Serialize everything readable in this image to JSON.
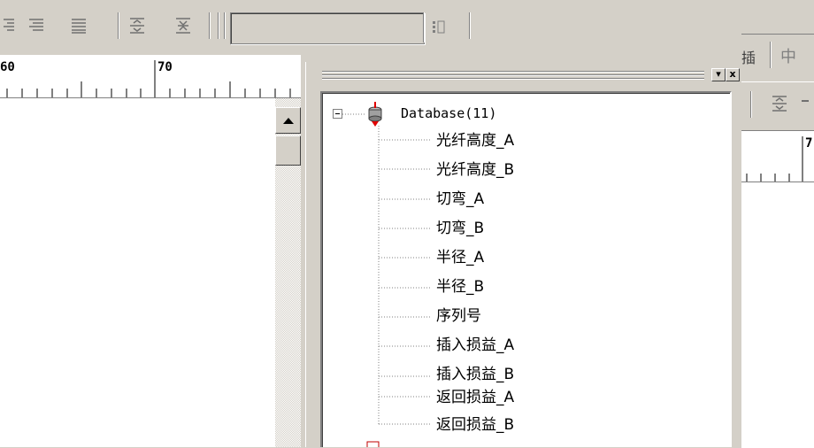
{
  "ruler": {
    "left_labels": [
      "60",
      "70"
    ],
    "right_label": "7"
  },
  "toolbar_right": {
    "partial_labels": [
      "插",
      "中"
    ]
  },
  "panel": {
    "minimize_glyph": "▾",
    "close_glyph": "x"
  },
  "tree": {
    "root": "Database(11)",
    "items": [
      "光纤高度_A",
      "光纤高度_B",
      "切弯_A",
      "切弯_B",
      "半径_A",
      "半径_B",
      "序列号",
      "插入损益_A",
      "插入损益_B",
      "返回损益_A",
      "返回损益_B"
    ]
  },
  "icons": {
    "database": "database-icon",
    "expander": "minus-box-icon"
  },
  "colors": {
    "face": "#d4d0c8",
    "window": "#ffffff",
    "shadow": "#808080",
    "db_red": "#e00000"
  }
}
